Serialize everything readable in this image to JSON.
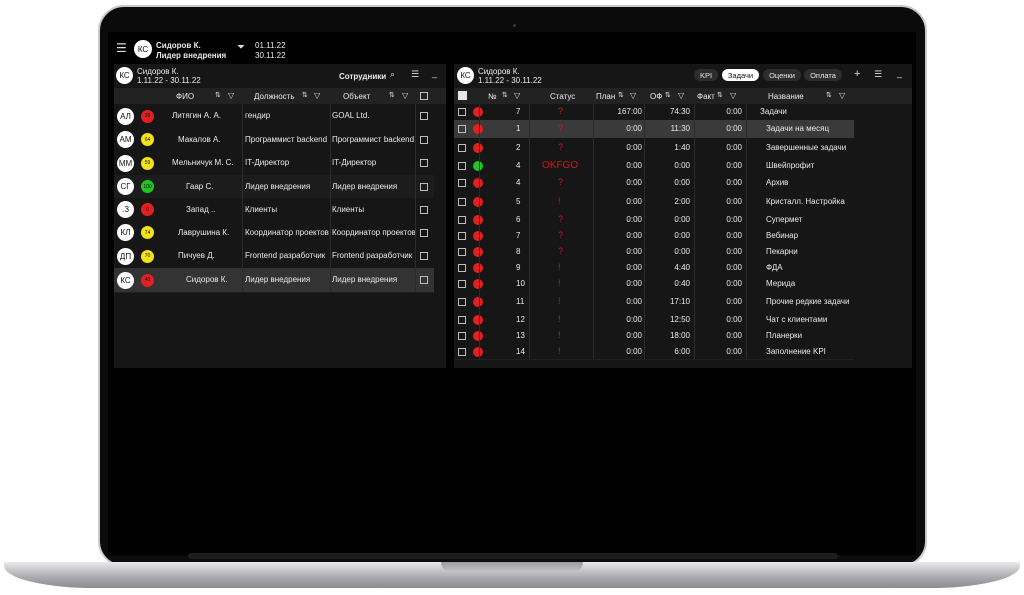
{
  "header": {
    "avatar": "КС",
    "user_name": "Сидоров К.",
    "user_role": "Лидер внедрения",
    "date_from": "01.11.22",
    "date_to": "30.11.22"
  },
  "left_panel": {
    "avatar": "КС",
    "user_name": "Сидоров К.",
    "period": "1.11.22 - 30.11.22",
    "employees_label": "Сотрудники",
    "columns": {
      "fio": "ФИО",
      "position": "Должность",
      "object": "Объект"
    },
    "rows": [
      {
        "initials": "АЛ",
        "badge": "38",
        "badge_color": "#e32020",
        "name": "Литягин А. А.",
        "position": "гендир",
        "object": "GOAL Ltd.",
        "marker": "edit"
      },
      {
        "initials": "АМ",
        "badge": "64",
        "badge_color": "#f2e21a",
        "name": "Макалов А.",
        "position": "Программист backend",
        "object": "Программист backend",
        "marker": ""
      },
      {
        "initials": "ММ",
        "badge": "59",
        "badge_color": "#f2e21a",
        "name": "Мельничук М. С.",
        "position": "IT-Директор",
        "object": "IT-Директор",
        "marker": "edit"
      },
      {
        "initials": "СГ",
        "badge": "100",
        "badge_color": "#22c422",
        "name": "Гаар С.",
        "position": "Лидер внедрения",
        "object": "Лидер внедрения",
        "marker": "chevron"
      },
      {
        "initials": ".З",
        "badge": "0",
        "badge_color": "#e32020",
        "name": "Запад ..",
        "position": "Клиенты",
        "object": "Клиенты",
        "marker": "chevron"
      },
      {
        "initials": "КЛ",
        "badge": "74",
        "badge_color": "#f2e21a",
        "name": "Лаврушина К.",
        "position": "Координатор проектов",
        "object": "Координатор проектов",
        "marker": ""
      },
      {
        "initials": "ДП",
        "badge": "70",
        "badge_color": "#f2e21a",
        "name": "Пичуев Д.",
        "position": "Frontend разработчик",
        "object": "Frontend разработчик",
        "marker": ""
      },
      {
        "initials": "КС",
        "badge": "40",
        "badge_color": "#e32020",
        "name": "Сидоров К.",
        "position": "Лидер внедрения",
        "object": "Лидер внедрения",
        "marker": "chevron"
      }
    ]
  },
  "right_panel": {
    "avatar": "КС",
    "user_name": "Сидоров К.",
    "period": "1.11.22 - 30.11.22",
    "tabs": [
      {
        "label": "KPI",
        "active": false
      },
      {
        "label": "Задачи",
        "active": true
      },
      {
        "label": "Оценки",
        "active": false
      },
      {
        "label": "Оплата",
        "active": false
      }
    ],
    "add_label": "+",
    "columns": {
      "num": "№",
      "status": "Статус",
      "plan": "План",
      "of": "ОФ",
      "fact": "Факт",
      "name": "Название"
    },
    "rows": [
      {
        "dot": "#e32020",
        "num": "7",
        "status": "?",
        "plan": "167:00",
        "of": "74:30",
        "fact": "0:00",
        "name": "Задачи",
        "marker": "edit"
      },
      {
        "dot": "#e32020",
        "num": "1",
        "status": "?",
        "plan": "0:00",
        "of": "11:30",
        "fact": "0:00",
        "name": "Задачи на месяц",
        "marker": "chevron"
      },
      {
        "dot": "#e32020",
        "num": "2",
        "status": "?",
        "plan": "0:00",
        "of": "1:40",
        "fact": "0:00",
        "name": "Завершенные задачи",
        "marker": "chevron"
      },
      {
        "dot": "#22c422",
        "num": "4",
        "status": "OKFGO",
        "plan": "0:00",
        "of": "0:00",
        "fact": "0:00",
        "name": "Швейпрофит",
        "marker": ""
      },
      {
        "dot": "#e32020",
        "num": "4",
        "status": "?",
        "plan": "0:00",
        "of": "0:00",
        "fact": "0:00",
        "name": "Архив",
        "marker": "chevron"
      },
      {
        "dot": "#e32020",
        "num": "5",
        "status": "!",
        "plan": "0:00",
        "of": "2:00",
        "fact": "0:00",
        "name": "Кристалл. Настройка",
        "marker": ""
      },
      {
        "dot": "#e32020",
        "num": "6",
        "status": "?",
        "plan": "0:00",
        "of": "0:00",
        "fact": "0:00",
        "name": "Супермет",
        "marker": ""
      },
      {
        "dot": "#e32020",
        "num": "7",
        "status": "?",
        "plan": "0:00",
        "of": "0:00",
        "fact": "0:00",
        "name": "Вебинар",
        "marker": ""
      },
      {
        "dot": "#e32020",
        "num": "8",
        "status": "?",
        "plan": "0:00",
        "of": "0:00",
        "fact": "0:00",
        "name": "Пекарни",
        "marker": ""
      },
      {
        "dot": "#e32020",
        "num": "9",
        "status": "!",
        "plan": "0:00",
        "of": "4:40",
        "fact": "0:00",
        "name": "ФДА",
        "marker": ""
      },
      {
        "dot": "#e32020",
        "num": "10",
        "status": "!",
        "plan": "0:00",
        "of": "0:40",
        "fact": "0:00",
        "name": "Мерида",
        "marker": ""
      },
      {
        "dot": "#e32020",
        "num": "11",
        "status": "!",
        "plan": "0:00",
        "of": "17:10",
        "fact": "0:00",
        "name": "Прочие редкие задачи",
        "marker": ""
      },
      {
        "dot": "#e32020",
        "num": "12",
        "status": "!",
        "plan": "0:00",
        "of": "12:50",
        "fact": "0:00",
        "name": "Чат с клиентами",
        "marker": ""
      },
      {
        "dot": "#e32020",
        "num": "13",
        "status": "!",
        "plan": "0:00",
        "of": "18:00",
        "fact": "0:00",
        "name": "Планерки",
        "marker": ""
      },
      {
        "dot": "#e32020",
        "num": "14",
        "status": "!",
        "plan": "0:00",
        "of": "6:00",
        "fact": "0:00",
        "name": "Заполнение KPI",
        "marker": ""
      }
    ]
  },
  "icons": {
    "menu": "menu-icon",
    "filter": "filter-icon",
    "search": "search-icon",
    "minimize": "minimize-icon",
    "sort": "sort-icon",
    "edit": "external-edit-icon",
    "chevron": "chevron-right-icon"
  },
  "colors": {
    "red": "#e32020",
    "yellow": "#f2e21a",
    "green": "#22c422",
    "status_red": "#d01818"
  }
}
